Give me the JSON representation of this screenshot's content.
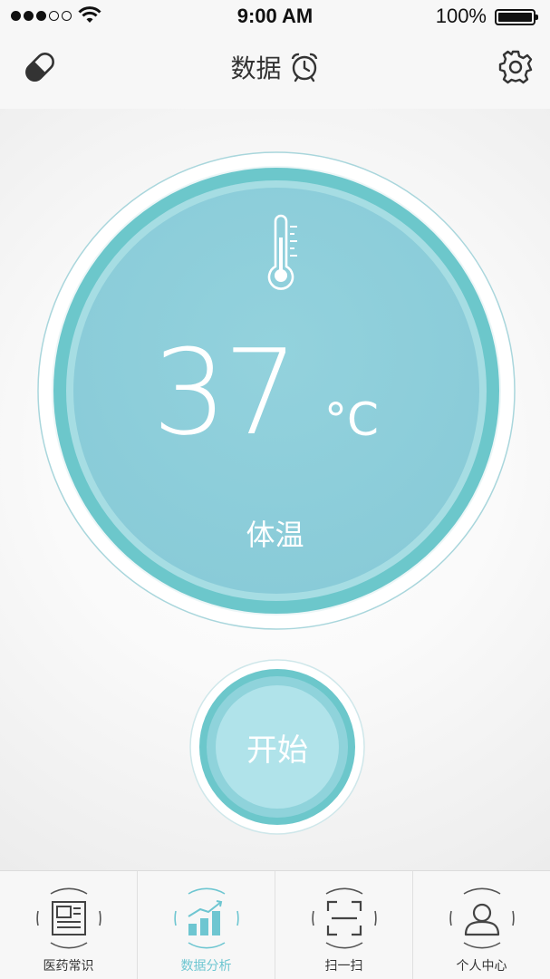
{
  "status_bar": {
    "time": "9:00 AM",
    "battery": "100%",
    "signal_dots_filled": 3,
    "signal_dots_total": 5
  },
  "nav": {
    "left_icon": "pill-icon",
    "title": "数据",
    "title_icon": "alarm-clock-icon",
    "right_icon": "gear-icon"
  },
  "reading": {
    "value": "37",
    "unit": "°C",
    "label": "体温",
    "icon": "thermometer-icon"
  },
  "start_button": {
    "label": "开始"
  },
  "tabs": [
    {
      "label": "医药常识",
      "icon": "news-icon",
      "active": false
    },
    {
      "label": "数据分析",
      "icon": "bar-chart-icon",
      "active": true
    },
    {
      "label": "扫一扫",
      "icon": "scan-icon",
      "active": false
    },
    {
      "label": "个人中心",
      "icon": "user-icon",
      "active": false
    }
  ],
  "colors": {
    "accent": "#6ec6d1",
    "ring": "#6cc7cb",
    "face": "#8ecfdb",
    "button_face": "#b0e3ea"
  }
}
